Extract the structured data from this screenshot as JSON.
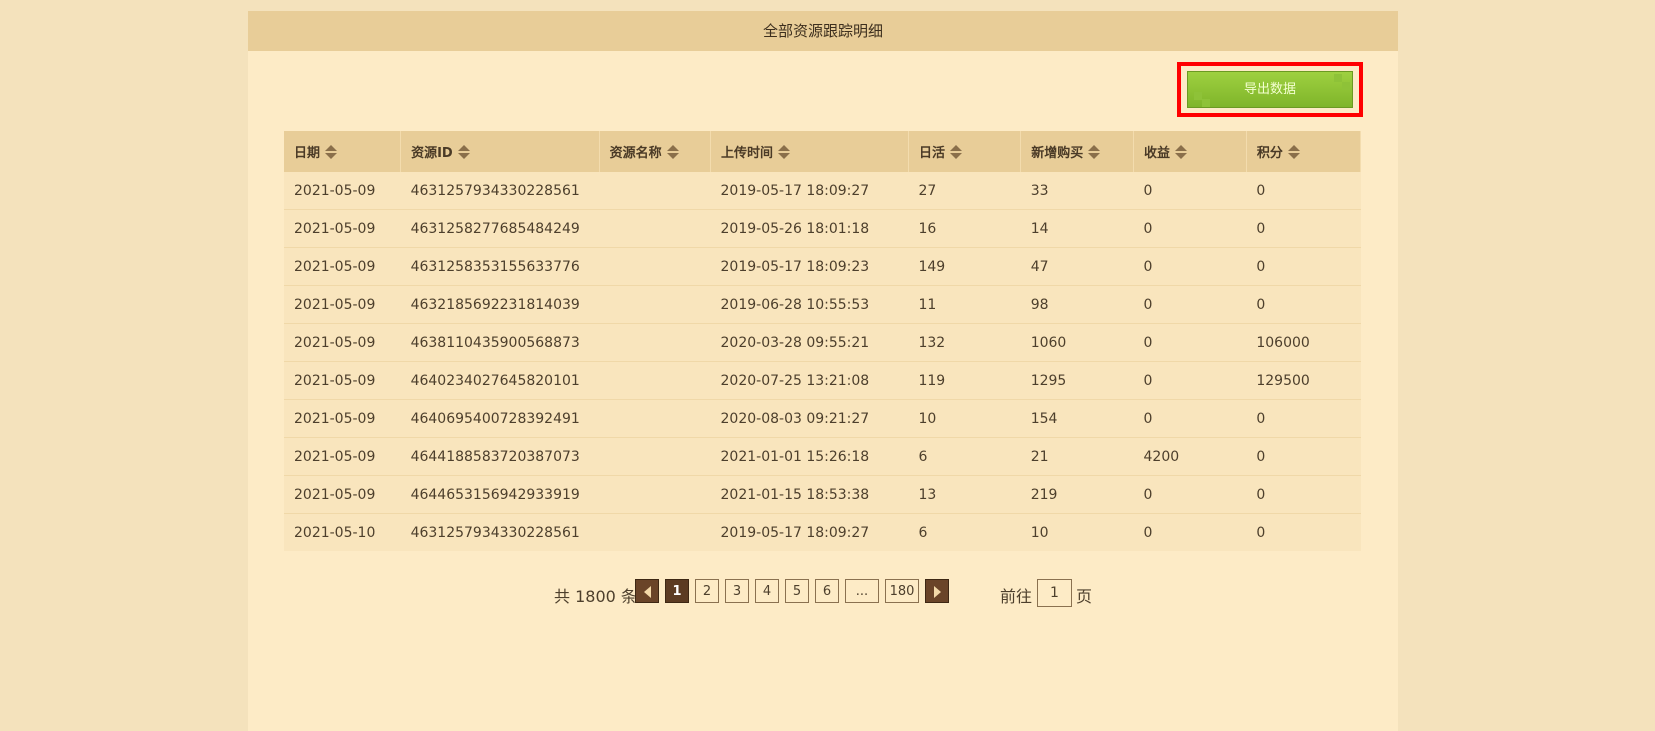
{
  "header": {
    "title": "全部资源跟踪明细"
  },
  "toolbar": {
    "export_label": "导出数据"
  },
  "table": {
    "columns": [
      "日期",
      "资源ID",
      "资源名称",
      "上传时间",
      "日活",
      "新增购买",
      "收益",
      "积分"
    ],
    "rows": [
      [
        "2021-05-09",
        "4631257934330228561",
        "",
        "2019-05-17 18:09:27",
        "27",
        "33",
        "0",
        "0"
      ],
      [
        "2021-05-09",
        "4631258277685484249",
        "",
        "2019-05-26 18:01:18",
        "16",
        "14",
        "0",
        "0"
      ],
      [
        "2021-05-09",
        "4631258353155633776",
        "",
        "2019-05-17 18:09:23",
        "149",
        "47",
        "0",
        "0"
      ],
      [
        "2021-05-09",
        "4632185692231814039",
        "",
        "2019-06-28 10:55:53",
        "11",
        "98",
        "0",
        "0"
      ],
      [
        "2021-05-09",
        "4638110435900568873",
        "",
        "2020-03-28 09:55:21",
        "132",
        "1060",
        "0",
        "106000"
      ],
      [
        "2021-05-09",
        "4640234027645820101",
        "",
        "2020-07-25 13:21:08",
        "119",
        "1295",
        "0",
        "129500"
      ],
      [
        "2021-05-09",
        "4640695400728392491",
        "",
        "2020-08-03 09:21:27",
        "10",
        "154",
        "0",
        "0"
      ],
      [
        "2021-05-09",
        "4644188583720387073",
        "",
        "2021-01-01 15:26:18",
        "6",
        "21",
        "4200",
        "0"
      ],
      [
        "2021-05-09",
        "4644653156942933919",
        "",
        "2021-01-15 18:53:38",
        "13",
        "219",
        "0",
        "0"
      ],
      [
        "2021-05-10",
        "4631257934330228561",
        "",
        "2019-05-17 18:09:27",
        "6",
        "10",
        "0",
        "0"
      ]
    ]
  },
  "pagination": {
    "total_text": "共 1800 条",
    "pages": [
      "1",
      "2",
      "3",
      "4",
      "5",
      "6",
      "...",
      "180"
    ],
    "active_page": "1",
    "goto_label": "前往",
    "goto_value": "1",
    "goto_suffix": "页"
  }
}
